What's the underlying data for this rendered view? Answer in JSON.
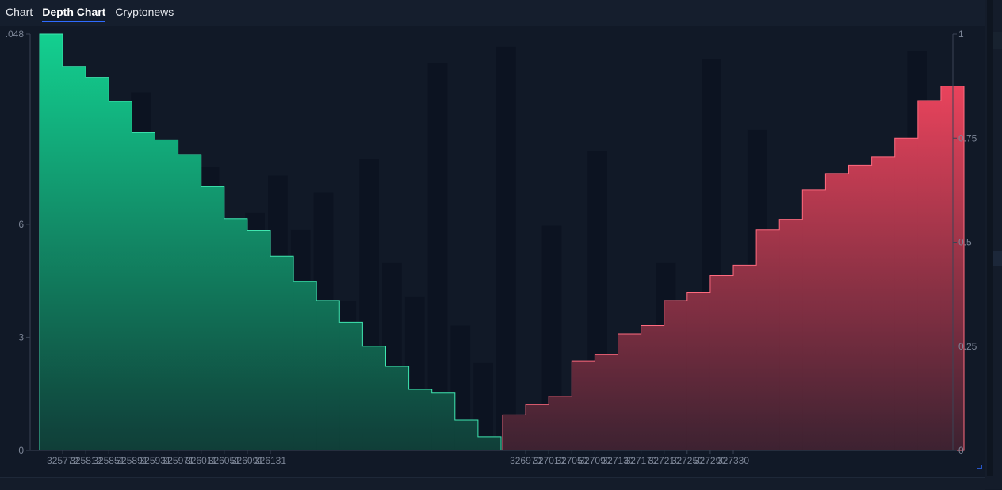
{
  "tabs": [
    {
      "label": "Chart",
      "active": false
    },
    {
      "label": "Depth Chart",
      "active": true
    },
    {
      "label": "Cryptonews",
      "active": false
    }
  ],
  "colors": {
    "bid": "#10d08f",
    "bid_dark": "#0d3b35",
    "ask": "#e9405a",
    "ask_dark": "#3a1f2e",
    "background": "#111927",
    "axis": "#3a4455",
    "tick_text": "#7c8596"
  },
  "chart_data": {
    "type": "area",
    "left_axis": {
      "ticks": [
        0,
        3,
        6
      ],
      "top_label": ".048",
      "range": [
        0,
        11.048
      ]
    },
    "right_axis": {
      "ticks": [
        "0",
        "0.25",
        "0.5",
        "0.75",
        "1"
      ],
      "range": [
        0,
        1
      ]
    },
    "x_tick_labels": [
      "325772",
      "325812",
      "325851",
      "325891",
      "325931",
      "325971",
      "326011",
      "326051",
      "326091",
      "326131",
      "326970",
      "327010",
      "327050",
      "327090",
      "327130",
      "327170",
      "327210",
      "327250",
      "327290",
      "327330"
    ],
    "series": [
      {
        "side": "bid",
        "x": [
          325752,
          325772,
          325792,
          325812,
          325832,
          325851,
          325871,
          325891,
          325911,
          325931,
          325951,
          325971,
          325991,
          326011,
          326031,
          326051,
          326071,
          326091,
          326111,
          326131
        ],
        "y": [
          11.048,
          10.19,
          9.9,
          9.26,
          8.43,
          8.24,
          7.85,
          7.0,
          6.15,
          5.84,
          5.15,
          4.48,
          3.98,
          3.4,
          2.76,
          2.23,
          1.62,
          1.52,
          0.8,
          0.36
        ]
      },
      {
        "side": "ask",
        "x": [
          326950,
          326970,
          326990,
          327010,
          327030,
          327050,
          327070,
          327090,
          327110,
          327130,
          327150,
          327170,
          327190,
          327210,
          327230,
          327250,
          327270,
          327290,
          327310,
          327330
        ],
        "y": [
          0.085,
          0.11,
          0.13,
          0.215,
          0.23,
          0.28,
          0.3,
          0.36,
          0.38,
          0.42,
          0.445,
          0.53,
          0.555,
          0.625,
          0.665,
          0.685,
          0.705,
          0.75,
          0.84,
          0.875
        ]
      }
    ],
    "background_volume_bars": [
      0.33,
      0.14,
      0.31,
      0.84,
      0.86,
      0.14,
      0.69,
      0.68,
      0.49,
      0.57,
      0.66,
      0.53,
      0.62,
      0.36,
      0.7,
      0.45,
      0.37,
      0.93,
      0.3,
      0.21,
      0.97,
      0.07,
      0.54,
      0.1,
      0.72,
      0.14,
      0.08,
      0.45,
      0.15,
      0.94,
      0.13,
      0.77,
      0.13,
      0.16,
      0.13,
      0.39,
      0.28,
      0.18,
      0.96,
      0.57
    ],
    "grid": false,
    "legend": "none"
  }
}
